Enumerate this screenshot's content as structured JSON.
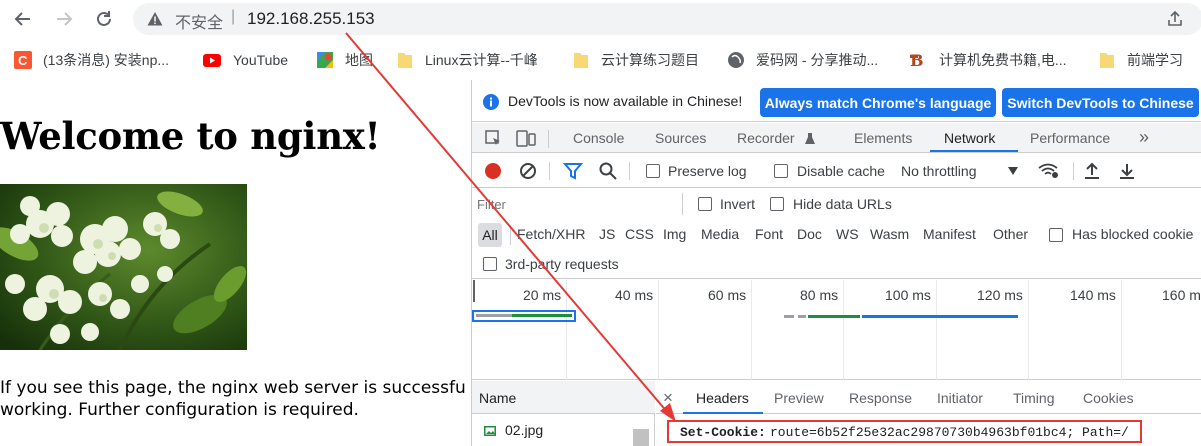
{
  "browser": {
    "security_label": "不安全",
    "separator": "|",
    "url": "192.168.255.153"
  },
  "bookmarks": [
    {
      "label": "(13条消息) 安装np...",
      "icon": "csdn-icon"
    },
    {
      "label": "YouTube",
      "icon": "youtube-icon"
    },
    {
      "label": "地图",
      "icon": "maps-icon"
    },
    {
      "label": "Linux云计算--千峰",
      "icon": "folder-icon"
    },
    {
      "label": "云计算练习题目",
      "icon": "folder-icon"
    },
    {
      "label": "爱码网 - 分享推动...",
      "icon": "globe-icon"
    },
    {
      "label": "计算机免费书籍,电...",
      "icon": "book-site-icon"
    },
    {
      "label": "前端学习",
      "icon": "folder-icon"
    }
  ],
  "page": {
    "heading": "Welcome to nginx!",
    "paragraph_line1": "If you see this page, the nginx web server is successfu",
    "paragraph_line2": "working. Further configuration is required."
  },
  "devtools": {
    "infobar": {
      "message": "DevTools is now available in Chinese!",
      "match_button": "Always match Chrome's language",
      "switch_button": "Switch DevTools to Chinese"
    },
    "tabs": [
      "Console",
      "Sources",
      "Recorder",
      "Elements",
      "Network",
      "Performance"
    ],
    "active_tab": "Network",
    "more_tabs": "»",
    "network_toolbar": {
      "preserve_log": "Preserve log",
      "disable_cache": "Disable cache",
      "throttling": "No throttling"
    },
    "filter": {
      "placeholder": "Filter",
      "invert": "Invert",
      "hide_data_urls": "Hide data URLs"
    },
    "types": [
      "All",
      "Fetch/XHR",
      "JS",
      "CSS",
      "Img",
      "Media",
      "Font",
      "Doc",
      "WS",
      "Wasm",
      "Manifest",
      "Other"
    ],
    "has_blocked_cookies": "Has blocked cookie",
    "third_party": "3rd-party requests",
    "timeline_ticks": [
      "20 ms",
      "40 ms",
      "60 ms",
      "80 ms",
      "100 ms",
      "120 ms",
      "140 ms",
      "160 m"
    ],
    "name_header": "Name",
    "requests": [
      {
        "name": "02.jpg"
      }
    ],
    "close_symbol": "×",
    "detail_tabs": [
      "Headers",
      "Preview",
      "Response",
      "Initiator",
      "Timing",
      "Cookies"
    ],
    "active_detail_tab": "Headers",
    "set_cookie_key": "Set-Cookie:",
    "set_cookie_value": "route=6b52f25e32ac29870730b4963bf01bc4; Path=/"
  },
  "colors": {
    "accent": "#1a73e8",
    "highlight_box": "#e53935",
    "arrow": "#e53935",
    "record": "#d93025"
  }
}
